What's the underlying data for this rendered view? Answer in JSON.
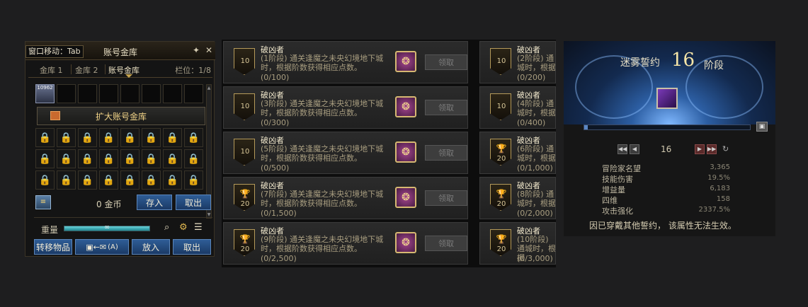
{
  "vault": {
    "hint": "窗口移动：Tab",
    "title": "账号金库",
    "pin_icon": "pin-icon",
    "close_icon": "close-icon",
    "tabs": [
      "金库 1",
      "金库 2",
      "账号金库"
    ],
    "slot_info": "栏位：1/8",
    "item_badge": "10962",
    "expand_label": "扩大账号金库",
    "gold_amount": "0 金币",
    "deposit_label": "存入",
    "withdraw_label": "取出",
    "weight_label": "重量",
    "weight_value": "∞",
    "transfer_label": "转移物品",
    "shortcut_label": "(A)",
    "put_label": "放入",
    "take_label": "取出"
  },
  "achievements": {
    "left": [
      {
        "title": "破凶者",
        "desc": "(1阶段) 通关逢魔之未央幻境地下城时，根据阶数获得相应点数。",
        "progress": "(0/100)",
        "badge": "10",
        "claim": "领取"
      },
      {
        "title": "破凶者",
        "desc": "(3阶段) 通关逢魔之未央幻境地下城时，根据阶数获得相应点数。",
        "progress": "(0/300)",
        "badge": "10",
        "claim": "领取"
      },
      {
        "title": "破凶者",
        "desc": "(5阶段) 通关逢魔之未央幻境地下城时，根据阶数获得相应点数。",
        "progress": "(0/500)",
        "badge": "10",
        "claim": "领取"
      },
      {
        "title": "破凶者",
        "desc": "(7阶段) 通关逢魔之未央幻境地下城时，根据阶数获得相应点数。",
        "progress": "(0/1,500)",
        "badge": "20",
        "claim": "领取"
      },
      {
        "title": "破凶者",
        "desc": "(9阶段) 通关逢魔之未央幻境地下城时，根据阶数获得相应点数。",
        "progress": "(0/2,500)",
        "badge": "20",
        "claim": "领取"
      }
    ],
    "right": [
      {
        "title": "破凶者",
        "desc": "(2阶段) 通城时，根据",
        "progress": "(0/200)",
        "badge": "10"
      },
      {
        "title": "破凶者",
        "desc": "(4阶段) 通城时，根据",
        "progress": "(0/400)",
        "badge": "10"
      },
      {
        "title": "破凶者",
        "desc": "(6阶段) 通城时，根据",
        "progress": "(0/1,000)",
        "badge": "20"
      },
      {
        "title": "破凶者",
        "desc": "(8阶段) 通城时，根据",
        "progress": "(0/2,000)",
        "badge": "20"
      },
      {
        "title": "破凶者",
        "desc": "(10阶段) 通城时，根据",
        "progress": "(0/3,000)",
        "badge": "20"
      }
    ]
  },
  "pact": {
    "title": "迷雾誓约",
    "stage": "16",
    "stage_suffix": "阶段",
    "progress": 0.02,
    "step_value": "16",
    "stats": [
      {
        "label": "冒险家名望",
        "value": "3,365"
      },
      {
        "label": "技能伤害",
        "value": "19.5%"
      },
      {
        "label": "增益量",
        "value": "6,183"
      },
      {
        "label": "四维",
        "value": "158"
      },
      {
        "label": "攻击强化",
        "value": "2337.5%"
      }
    ],
    "note": "因已穿戴其他誓约， 该属性无法生效。"
  }
}
